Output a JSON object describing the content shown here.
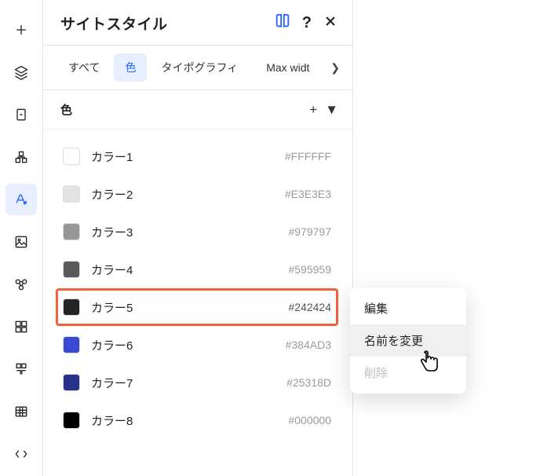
{
  "panel": {
    "title": "サイトスタイル"
  },
  "filters": {
    "all": "すべて",
    "color": "色",
    "typo": "タイポグラフィ",
    "max": "Max widt"
  },
  "section": {
    "color_label": "色"
  },
  "colors": [
    {
      "name": "カラー1",
      "value": "#FFFFFF",
      "swatch": "#ffffff"
    },
    {
      "name": "カラー2",
      "value": "#E3E3E3",
      "swatch": "#e3e3e3"
    },
    {
      "name": "カラー3",
      "value": "#979797",
      "swatch": "#979797"
    },
    {
      "name": "カラー4",
      "value": "#595959",
      "swatch": "#595959"
    },
    {
      "name": "カラー5",
      "value": "#242424",
      "swatch": "#242424"
    },
    {
      "name": "カラー6",
      "value": "#384AD3",
      "swatch": "#384AD3"
    },
    {
      "name": "カラー7",
      "value": "#25318D",
      "swatch": "#25318D"
    },
    {
      "name": "カラー8",
      "value": "#000000",
      "swatch": "#000000"
    }
  ],
  "ctx": {
    "edit": "編集",
    "rename": "名前を変更",
    "delete": "削除"
  }
}
